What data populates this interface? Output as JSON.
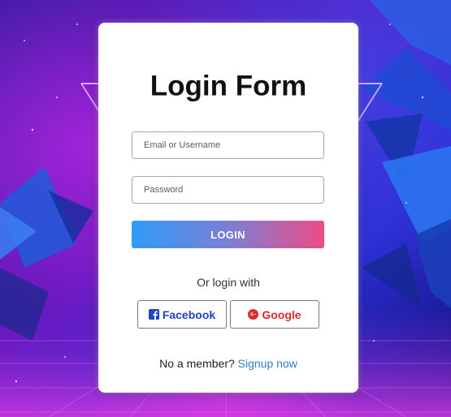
{
  "colors": {
    "card_background": "#ffffff",
    "login_gradient_start": "#2f9bf7",
    "login_gradient_end": "#ec4d86",
    "facebook": "#1d43c6",
    "google": "#e32a2a",
    "link": "#2f7fc7"
  },
  "form": {
    "title": "Login Form",
    "email_placeholder": "Email or Username",
    "email_value": "",
    "password_placeholder": "Password",
    "password_value": "",
    "login_label": "LOGIN",
    "or_text": "Or login with"
  },
  "social": {
    "facebook": {
      "label": "Facebook",
      "icon": "facebook-icon"
    },
    "google": {
      "label": "Google",
      "icon": "google-plus-icon"
    }
  },
  "signup": {
    "prompt": "No a member?",
    "link_label": "Signup now"
  }
}
